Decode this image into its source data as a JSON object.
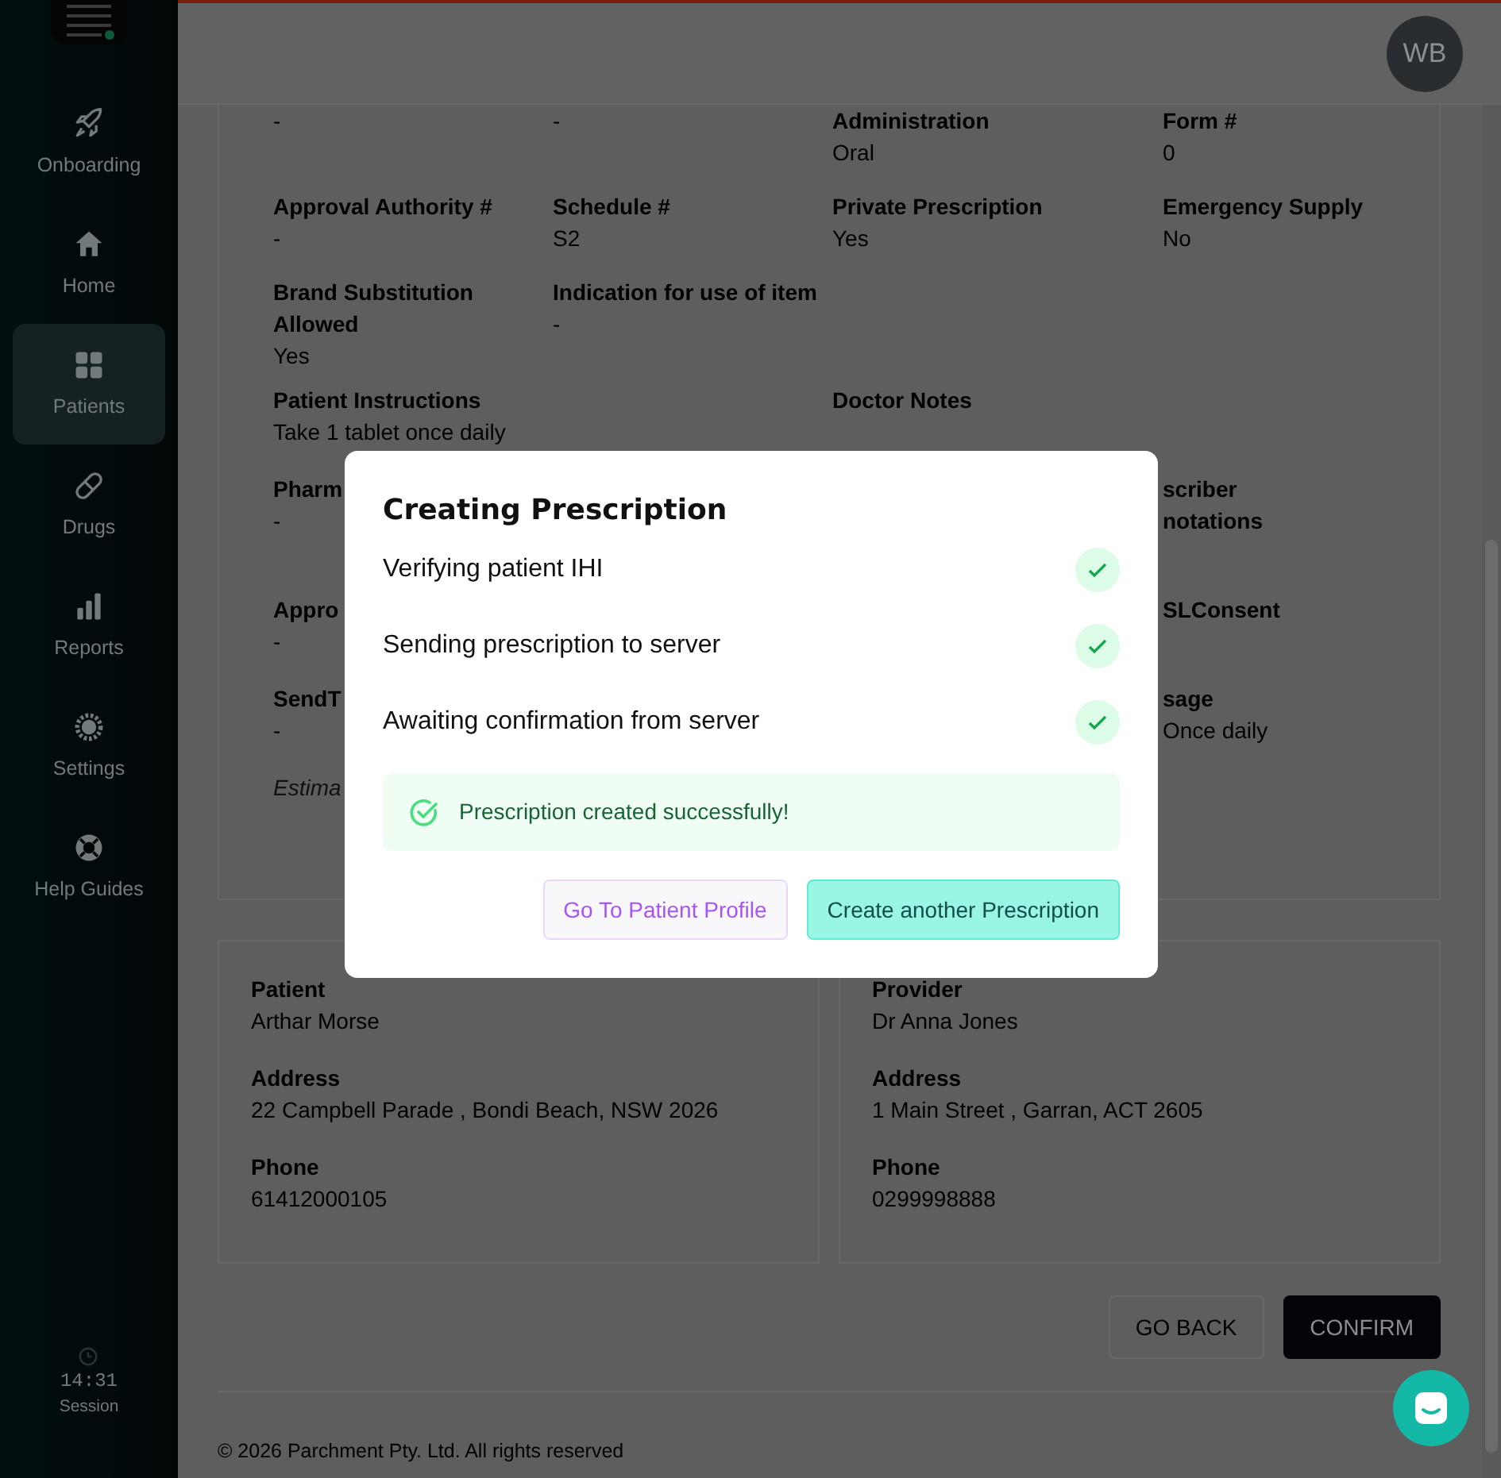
{
  "sidebar": {
    "items": [
      {
        "label": "Onboarding",
        "selected": false
      },
      {
        "label": "Home",
        "selected": false
      },
      {
        "label": "Patients",
        "selected": true
      },
      {
        "label": "Drugs",
        "selected": false
      },
      {
        "label": "Reports",
        "selected": false
      },
      {
        "label": "Settings",
        "selected": false
      },
      {
        "label": "Help Guides",
        "selected": false
      }
    ],
    "session": {
      "time": "14:31",
      "label": "Session"
    }
  },
  "header": {
    "avatar": "WB"
  },
  "details": {
    "rows": [
      [
        {
          "value": "-"
        },
        {
          "value": "-"
        },
        {
          "label": "Administration",
          "value": "Oral"
        },
        {
          "label": "Form #",
          "value": "0"
        }
      ],
      [
        {
          "label": "Approval Authority #",
          "value": "-"
        },
        {
          "label": "Schedule #",
          "value": "S2"
        },
        {
          "label": "Private Prescription",
          "value": "Yes"
        },
        {
          "label": "Emergency Supply",
          "value": "No"
        }
      ],
      [
        {
          "label": "Brand Substitution Allowed",
          "value": "Yes"
        },
        {
          "label": "Indication for use of item",
          "value": "-"
        },
        {},
        {}
      ],
      [
        {
          "label": "Patient Instructions",
          "value": "Take 1 tablet once daily"
        },
        {},
        {
          "label": "Doctor Notes"
        },
        {}
      ],
      [
        {
          "label": "Pharm",
          "value": "-"
        },
        {},
        {},
        {
          "label": "scriber notations"
        }
      ],
      [
        {
          "label": "Appro",
          "value": "-"
        },
        {},
        {},
        {
          "label": "SLConsent"
        }
      ],
      [
        {
          "label": "SendT",
          "value": "-"
        },
        {},
        {},
        {
          "label": "sage",
          "value": "Once daily"
        }
      ],
      [
        {
          "kind": "note",
          "label": "Estima"
        },
        {},
        {},
        {}
      ]
    ]
  },
  "parties": [
    {
      "fields": [
        {
          "label": "Patient",
          "value": "Arthar Morse"
        },
        {
          "label": "Address",
          "value": "22 Campbell Parade , Bondi Beach, NSW 2026"
        },
        {
          "label": "Phone",
          "value": "61412000105"
        }
      ]
    },
    {
      "fields": [
        {
          "label": "Provider",
          "value": "Dr Anna Jones"
        },
        {
          "label": "Address",
          "value": "1 Main Street , Garran, ACT 2605"
        },
        {
          "label": "Phone",
          "value": "0299998888"
        }
      ]
    }
  ],
  "actions": [
    {
      "label": "GO BACK",
      "kind": "secondary"
    },
    {
      "label": "CONFIRM",
      "kind": "primary"
    }
  ],
  "footer": "© 2026 Parchment Pty. Ltd. All rights reserved",
  "modal": {
    "title": "Creating Prescription",
    "steps": [
      {
        "label": "Verifying patient IHI",
        "done": true
      },
      {
        "label": "Sending prescription to server",
        "done": true
      },
      {
        "label": "Awaiting confirmation from server",
        "done": true
      }
    ],
    "alert": "Prescription created successfully!",
    "buttons": [
      {
        "label": "Go To Patient Profile",
        "kind": "secondary"
      },
      {
        "label": "Create another Prescription",
        "kind": "primary"
      }
    ]
  }
}
